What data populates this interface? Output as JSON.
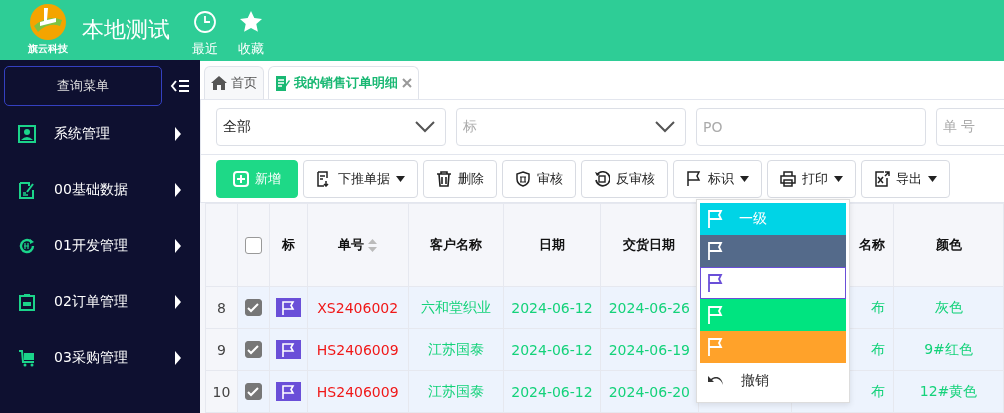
{
  "header": {
    "logo_text": "旗云科技",
    "title": "本地测试",
    "actions": [
      {
        "kind": "recent",
        "label": "最近"
      },
      {
        "kind": "favorite",
        "label": "收藏"
      }
    ]
  },
  "sidebar": {
    "search_button": "查询菜单",
    "items": [
      {
        "kind": "user",
        "label": "系统管理"
      },
      {
        "kind": "edit",
        "label": "00基础数据"
      },
      {
        "kind": "cycle",
        "label": "01开发管理"
      },
      {
        "kind": "clipboard",
        "label": "02订单管理"
      },
      {
        "kind": "cart",
        "label": "03采购管理"
      }
    ]
  },
  "tabs": [
    {
      "kind": "home",
      "label": "首页",
      "selected": false
    },
    {
      "kind": "doc",
      "label": "我的销售订单明细",
      "selected": true
    }
  ],
  "filters": [
    {
      "kind": "select",
      "value": "全部"
    },
    {
      "kind": "select",
      "placeholder": "标"
    },
    {
      "kind": "input",
      "placeholder": "PO"
    },
    {
      "kind": "input",
      "placeholder": "单 号"
    }
  ],
  "toolbar": [
    {
      "kind": "add",
      "label": "新增",
      "dropdown": false
    },
    {
      "kind": "push",
      "label": "下推单据",
      "dropdown": true
    },
    {
      "kind": "delete",
      "label": "删除",
      "dropdown": false
    },
    {
      "kind": "audit",
      "label": "审核",
      "dropdown": false
    },
    {
      "kind": "unaudit",
      "label": "反审核",
      "dropdown": false
    },
    {
      "kind": "flag",
      "label": "标识",
      "dropdown": true
    },
    {
      "kind": "print",
      "label": "打印",
      "dropdown": true
    },
    {
      "kind": "export",
      "label": "导出",
      "dropdown": true
    }
  ],
  "flag_menu": [
    {
      "kind": "flag",
      "label": "一级",
      "color": "#00d4e6",
      "selected": false
    },
    {
      "kind": "flag",
      "color": "#546a8a",
      "selected": false
    },
    {
      "kind": "flag",
      "color": "#6a4fd8",
      "selected": true
    },
    {
      "kind": "flag",
      "color": "#00e480",
      "selected": false
    },
    {
      "kind": "flag",
      "color": "#ffa22a",
      "selected": false
    },
    {
      "kind": "undo",
      "label": "撤销"
    }
  ],
  "table": {
    "header_checked": false,
    "flag_column": "标",
    "columns": [
      "单号",
      "客户名称",
      "日期",
      "交货日期",
      "",
      "名称",
      "颜色"
    ],
    "rows": [
      {
        "index": "8",
        "checked": true,
        "color": "#6a4fd8",
        "cells": [
          "XS2406002",
          "六和堂织业",
          "2024-06-12",
          "2024-06-26",
          "",
          "布",
          "灰色"
        ]
      },
      {
        "index": "9",
        "checked": true,
        "color": "#6a4fd8",
        "cells": [
          "HS2406009",
          "江苏国泰",
          "2024-06-12",
          "2024-06-19",
          "",
          "布",
          "9#红色"
        ]
      },
      {
        "index": "10",
        "checked": true,
        "color": "#6a4fd8",
        "cells": [
          "HS2406009",
          "江苏国泰",
          "2024-06-12",
          "2024-06-20",
          "",
          "布",
          "12#黄色"
        ]
      }
    ]
  }
}
